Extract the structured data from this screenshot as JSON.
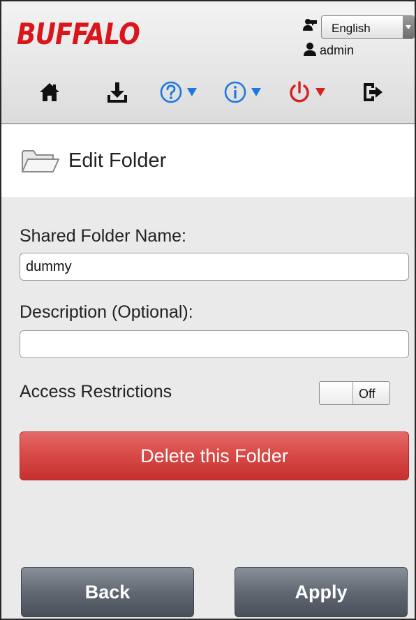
{
  "header": {
    "logo_text": "BUFFALO",
    "language": {
      "selected": "English"
    },
    "user": {
      "name": "admin"
    },
    "toolbar": {
      "items": [
        {
          "icon": "home-icon"
        },
        {
          "icon": "download-icon"
        },
        {
          "icon": "help-icon",
          "has_dropdown": true
        },
        {
          "icon": "info-icon",
          "has_dropdown": true
        },
        {
          "icon": "power-icon",
          "has_dropdown": true
        },
        {
          "icon": "logout-icon"
        }
      ]
    }
  },
  "page": {
    "title": "Edit Folder",
    "title_icon": "folder-icon"
  },
  "form": {
    "folder_name": {
      "label": "Shared Folder Name:",
      "value": "dummy"
    },
    "description": {
      "label": "Description (Optional):",
      "value": ""
    },
    "access_restrictions": {
      "label": "Access Restrictions",
      "state": "Off"
    },
    "delete_button": "Delete this Folder"
  },
  "footer": {
    "back_button": "Back",
    "apply_button": "Apply"
  },
  "colors": {
    "brand_red": "#d9161c",
    "help_blue": "#1e78e0",
    "power_red": "#d62020",
    "delete_red": "#d84b48",
    "footer_gray": "#5f6570"
  }
}
